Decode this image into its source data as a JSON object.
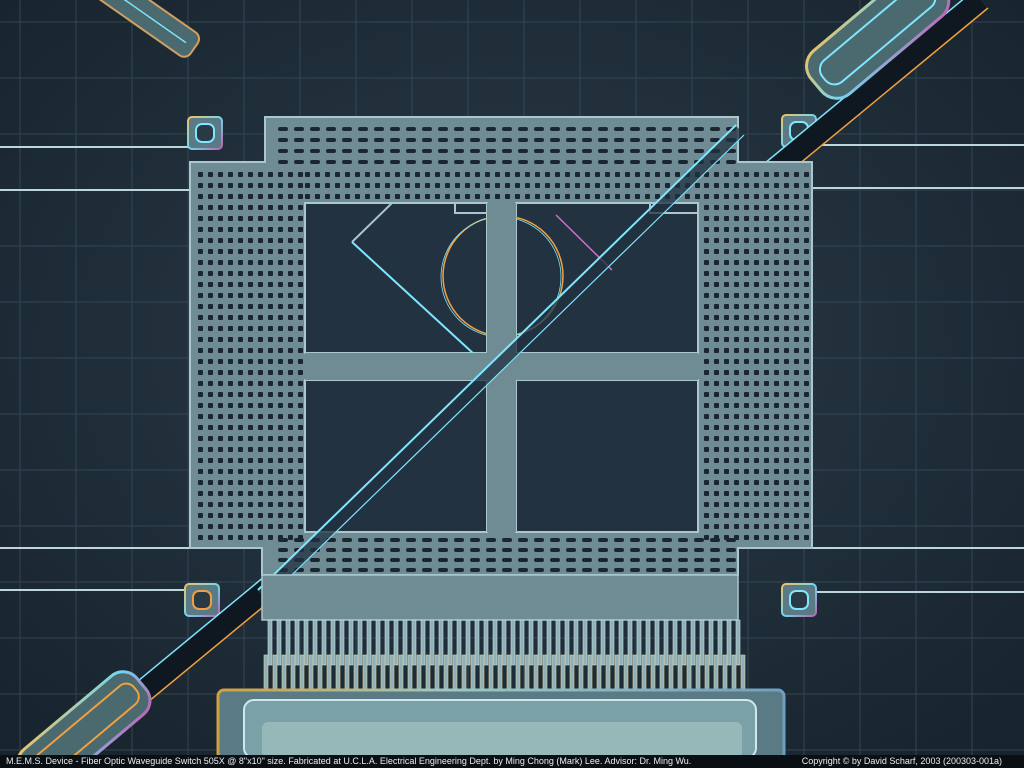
{
  "caption": {
    "left": "M.E.M.S. Device - Fiber Optic Waveguide Switch  505X @ 8\"x10\" size.   Fabricated at U.C.L.A. Electrical Engineering Dept. by Ming Chong (Mark) Lee.  Advisor: Dr. Ming Wu.",
    "right": "Copyright © by David Scharf, 2003   (200303-001a)"
  },
  "colors": {
    "background": "#1c2a35",
    "grid": "#3a4c5a",
    "structure": "#6f8c95",
    "structure_edge": "#a9c7cc",
    "hole": "#1a2630",
    "highlight_cyan": "#7fe6ff",
    "highlight_orange": "#f0a040",
    "highlight_magenta": "#d070c0",
    "caption_bg": "#0a0f14",
    "caption_text": "#e8eef2"
  }
}
